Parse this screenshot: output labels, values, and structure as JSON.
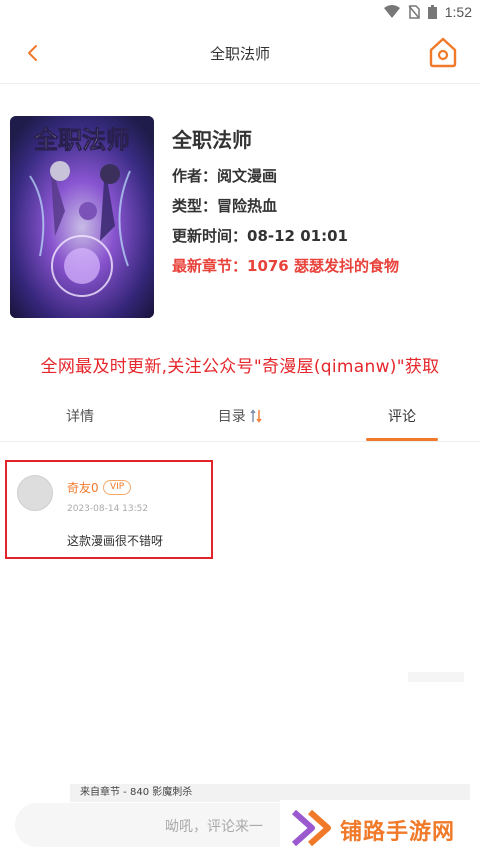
{
  "statusbar": {
    "time": "1:52"
  },
  "nav": {
    "title": "全职法师"
  },
  "book": {
    "name": "全职法师",
    "author": "作者：阅文漫画",
    "genre": "类型：冒险热血",
    "updated": "更新时间：08-12 01:01",
    "latest": "最新章节：1076 瑟瑟发抖的食物",
    "cover_title": "全职法师"
  },
  "notice": "全网最及时更新,关注公众号\"奇漫屋(qimanw)\"获取",
  "tabs": [
    {
      "label": "详情"
    },
    {
      "label": "目录"
    },
    {
      "label": "评论"
    }
  ],
  "comment": {
    "username": "奇友0",
    "badge": "VIP",
    "date": "2023-08-14 13:52",
    "text": "这款漫画很不错呀",
    "chapter": "来自章节 - 840 影魔刺杀"
  },
  "input": {
    "placeholder": "呦吼，评论来一"
  },
  "watermark": "铺路手游网",
  "colors": {
    "accent": "#f07a2a",
    "notice_red": "#e5262b",
    "latest_red": "#e8423b",
    "highlight_box": "#e0242a"
  }
}
